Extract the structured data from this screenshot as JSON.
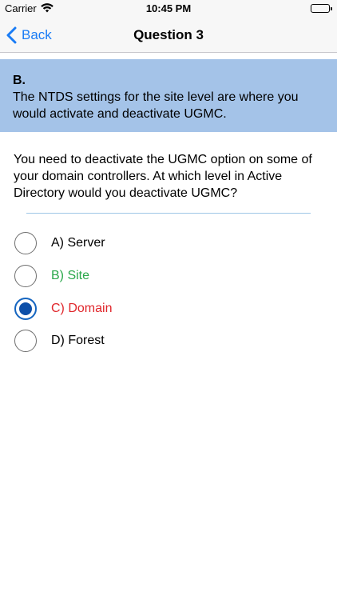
{
  "status_bar": {
    "carrier": "Carrier",
    "time": "10:45 PM"
  },
  "nav": {
    "back_label": "Back",
    "title": "Question 3"
  },
  "answer": {
    "letter": "B.",
    "explanation": "The NTDS settings for the site level are where you would activate and deactivate UGMC."
  },
  "question": {
    "text": "You need to deactivate the UGMC option on some of your domain controllers. At which level in Active Directory would you deactivate UGMC?"
  },
  "options": [
    {
      "label": "A) Server",
      "color": "#000000",
      "selected": false
    },
    {
      "label": "B) Site",
      "color": "#2aa84a",
      "selected": false
    },
    {
      "label": "C) Domain",
      "color": "#e0262b",
      "selected": true
    },
    {
      "label": "D) Forest",
      "color": "#000000",
      "selected": false
    }
  ],
  "colors": {
    "accent": "#1a7cf5",
    "banner": "#a4c3e8",
    "correct": "#2aa84a",
    "wrong": "#e0262b"
  }
}
